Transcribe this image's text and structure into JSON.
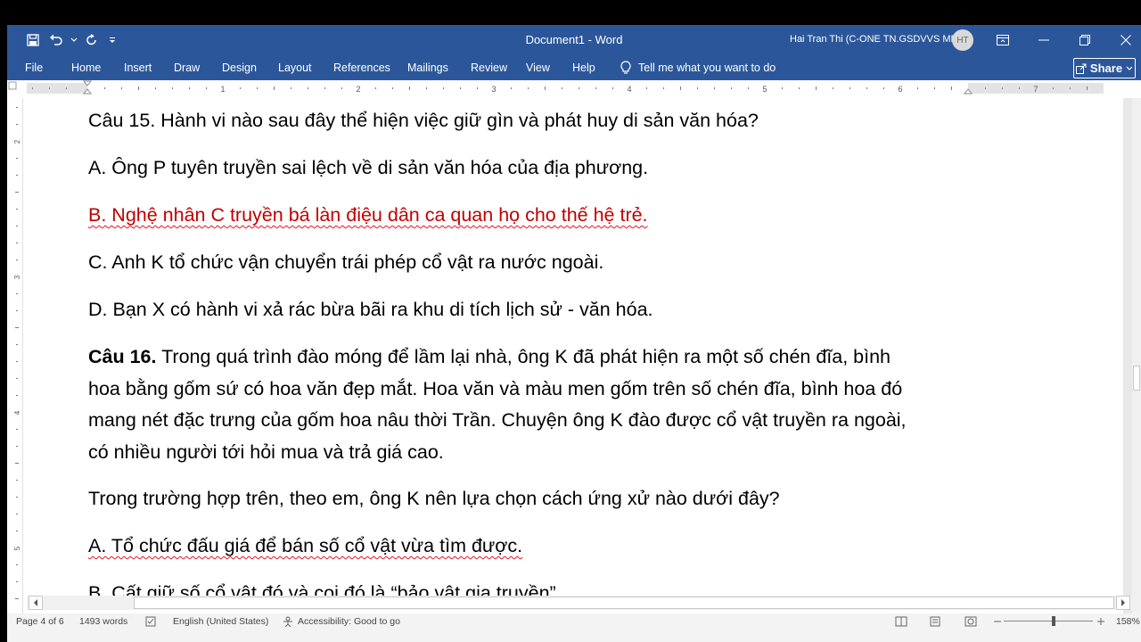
{
  "window": {
    "title": "Document1  -  Word",
    "user_name": "Hai Tran Thi (C-ONE TN.GSDVVS MB)",
    "user_initials": "HT"
  },
  "quick_access": {
    "save_icon": "save-icon",
    "undo_icon": "undo-icon",
    "redo_icon": "redo-icon",
    "customize_icon": "dropdown-arrow-icon"
  },
  "ribbon": {
    "tabs": [
      "File",
      "Home",
      "Insert",
      "Draw",
      "Design",
      "Layout",
      "References",
      "Mailings",
      "Review",
      "View",
      "Help"
    ],
    "tell_me": "Tell me what you want to do",
    "share": "Share"
  },
  "ruler": {
    "numbers": [
      "1",
      "2",
      "3",
      "4",
      "5",
      "6",
      "7"
    ],
    "vertical_numbers": [
      "2",
      "3",
      "4",
      "5"
    ]
  },
  "document": {
    "partial_top": "Câu 15. Hành vi nào sau đây thể hiện việc giữ gìn và phát huy di sản văn hóa?",
    "options_q15": {
      "a": "A. Ông P tuyên truyền sai lệch về di sản văn hóa của địa phương.",
      "b": "B. Nghệ nhân C truyền bá làn điệu dân ca quan họ cho thế hệ trẻ.",
      "c": "C. Anh K tổ chức vận chuyển trái phép cổ vật ra nước ngoài.",
      "d": "D. Bạn X có hành vi xả rác bừa bãi ra khu di tích lịch sử - văn hóa."
    },
    "q16_label": "Câu 16.",
    "q16_lines": [
      "Trong quá trình đào móng để lầm lại nhà, ông K đã phát hiện ra một số chén đĩa, bình",
      "hoa bằng gốm sứ có hoa văn đẹp mắt. Hoa văn và màu men gốm trên số chén đĩa, bình hoa đó",
      "mang nét đặc trưng của gốm hoa nâu thời Trần. Chuyện ông K đào được cổ vật truyền ra ngoài,",
      "có nhiều người tới hỏi mua và trả giá cao."
    ],
    "q16_prompt": "Trong trường hợp trên, theo em, ông K nên lựa chọn cách ứng xử nào dưới đây?",
    "options_q16": {
      "a": "A. Tổ chức đấu giá để bán số cổ vật vừa tìm được.",
      "b": "B. Cất giữ số cổ vật đó và coi đó là “bảo vật gia truyền”."
    }
  },
  "status_bar": {
    "page": "Page 4 of 6",
    "words": "1493 words",
    "language": "English (United States)",
    "accessibility": "Accessibility: Good to go",
    "zoom": "158%"
  },
  "colors": {
    "title_bar": "#2b579a",
    "answer_red": "#c00000",
    "status_bg": "#f3f3f3"
  }
}
